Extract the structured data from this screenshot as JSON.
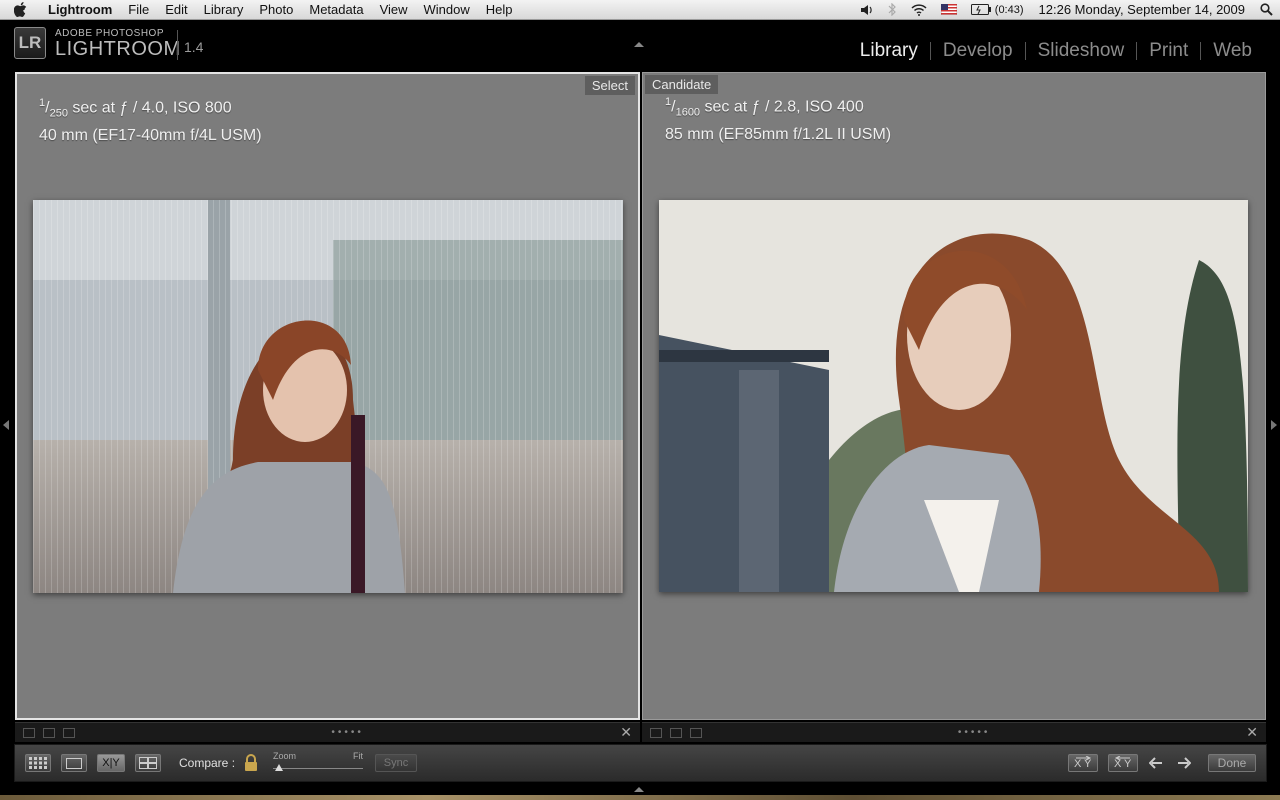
{
  "menubar": {
    "app": "Lightroom",
    "items": [
      "File",
      "Edit",
      "Library",
      "Photo",
      "Metadata",
      "View",
      "Window",
      "Help"
    ],
    "battery": "(0:43)",
    "clock": "12:26 Monday, September 14, 2009"
  },
  "logo": {
    "badge": "LR",
    "line1": "ADOBE PHOTOSHOP",
    "line2": "LIGHTROOM",
    "version": "1.4"
  },
  "modules": [
    "Library",
    "Develop",
    "Slideshow",
    "Print",
    "Web"
  ],
  "active_module": "Library",
  "left_pane": {
    "tag": "Select",
    "exposure_num": "1",
    "exposure_den": "250",
    "exposure_rest": " sec at ƒ / 4.0, ISO 800",
    "lens": "40 mm (EF17-40mm f/4L USM)"
  },
  "right_pane": {
    "tag": "Candidate",
    "exposure_num": "1",
    "exposure_den": "1600",
    "exposure_rest": " sec at ƒ / 2.8, ISO 400",
    "lens": "85 mm (EF85mm f/1.2L II USM)"
  },
  "toolbar": {
    "compare_label": "Compare :",
    "zoom_label": "Zoom",
    "fit_label": "Fit",
    "sync_label": "Sync",
    "compare_btn_label": "X|Y",
    "done_label": "Done"
  },
  "icons": {
    "grid": "grid-icon",
    "loupe": "loupe-icon",
    "compare": "compare-icon",
    "survey": "survey-icon",
    "lock": "lock-icon",
    "swap": "swap-icon",
    "make_select": "make-select-icon",
    "prev": "arrow-left-icon",
    "next": "arrow-right-icon"
  },
  "colors": {
    "pane_bg": "#7c7c7c",
    "active_module": "#ededed",
    "inactive_module": "#8c8c8c"
  }
}
